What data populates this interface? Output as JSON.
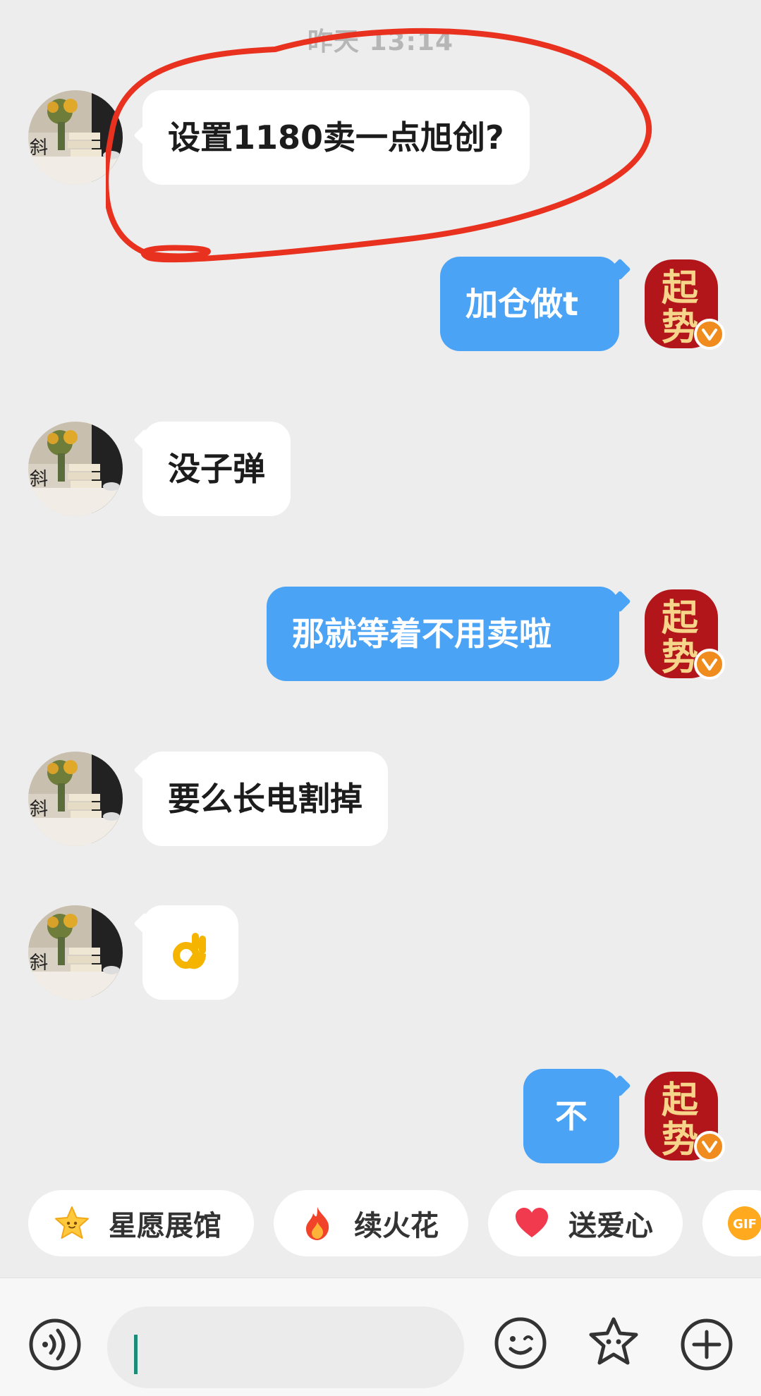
{
  "chat": {
    "timestamp": "昨天 13:14",
    "messages": [
      {
        "side": "in",
        "text": "设置1180卖一点旭创?"
      },
      {
        "side": "out",
        "text": "加仓做t"
      },
      {
        "side": "in",
        "text": "没子弹"
      },
      {
        "side": "out",
        "text": "那就等着不用卖啦"
      },
      {
        "side": "in",
        "text": "要么长电割掉"
      },
      {
        "side": "in",
        "text": "👌"
      },
      {
        "side": "out",
        "text": "不"
      }
    ],
    "self_avatar_text": "起势"
  },
  "quick_actions": [
    {
      "label": "星愿展馆",
      "icon": "star-icon"
    },
    {
      "label": "续火花",
      "icon": "fire-icon"
    },
    {
      "label": "送爱心",
      "icon": "heart-icon"
    },
    {
      "label": "GIF",
      "icon": "gif-icon"
    }
  ],
  "input": {
    "value": "",
    "placeholder": ""
  },
  "colors": {
    "background": "#ededed",
    "outgoing_bubble": "#4aa3f5",
    "incoming_bubble": "#ffffff",
    "annotation_red": "#e8321f",
    "verified_badge": "#f08c1e"
  }
}
